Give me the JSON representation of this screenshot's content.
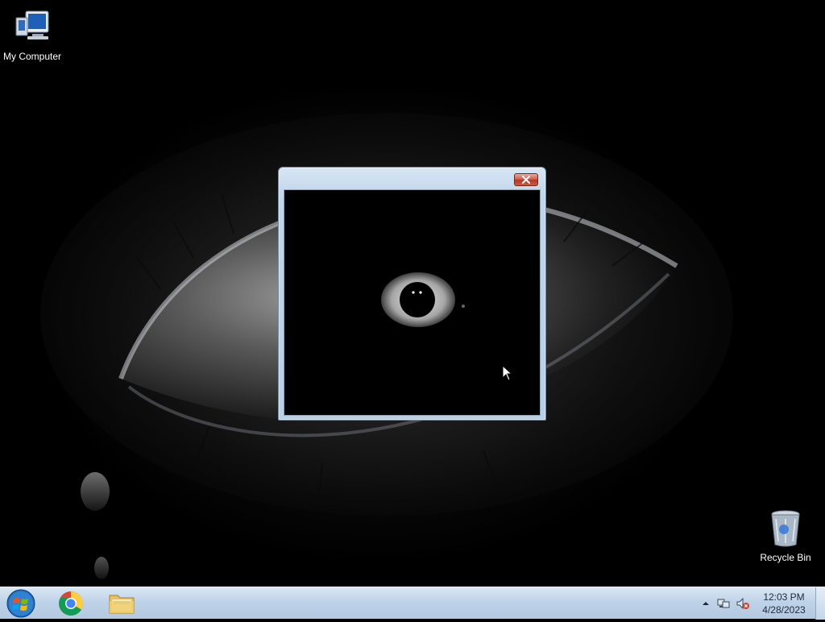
{
  "desktop": {
    "icons": [
      {
        "label": "My Computer",
        "icon": "computer-icon"
      },
      {
        "label": "Recycle Bin",
        "icon": "recycle-bin-icon"
      }
    ]
  },
  "window": {
    "title": "",
    "close_icon": "close-icon"
  },
  "taskbar": {
    "start_icon": "windows-logo-icon",
    "pinned": [
      {
        "name": "Google Chrome",
        "icon": "chrome-icon"
      },
      {
        "name": "Windows Explorer",
        "icon": "folder-icon"
      }
    ],
    "tray": {
      "icons": [
        "show-hidden-icons-icon",
        "network-icon",
        "volume-muted-icon"
      ],
      "time": "12:03 PM",
      "date": "4/28/2023"
    }
  },
  "colors": {
    "taskbar": "#c5d7ea",
    "window_frame": "#bfd5ea",
    "close_button": "#c8473a"
  }
}
